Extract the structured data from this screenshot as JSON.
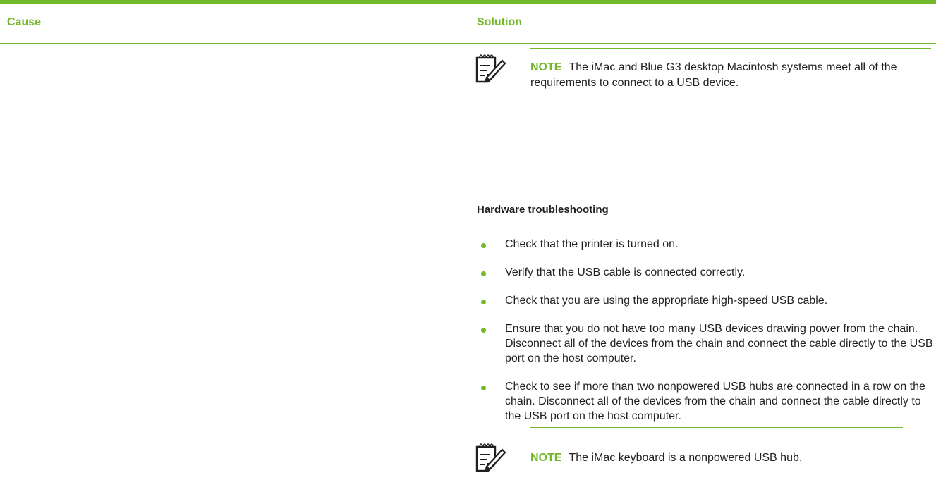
{
  "table": {
    "header": {
      "cause": "Cause",
      "solution": "Solution"
    }
  },
  "notes": [
    {
      "label": "NOTE",
      "icon": "note-pencil-icon",
      "text": "The iMac and Blue G3 desktop Macintosh systems meet all of the requirements to connect to a USB device."
    },
    {
      "label": "NOTE",
      "icon": "note-pencil-icon",
      "text": "The iMac keyboard is a nonpowered USB hub."
    }
  ],
  "section": {
    "heading": "Hardware troubleshooting",
    "bullets": [
      "Check that the printer is turned on.",
      "Verify that the USB cable is connected correctly.",
      "Check that you are using the appropriate high-speed USB cable.",
      "Ensure that you do not have too many USB devices drawing power from the chain. Disconnect all of the devices from the chain and connect the cable directly to the USB port on the host computer.",
      "Check to see if more than two nonpowered USB hubs are connected in a row on the chain. Disconnect all of the devices from the chain and connect the cable directly to the USB port on the host computer."
    ]
  },
  "colors": {
    "accent": "#73b72b",
    "text": "#231f20"
  }
}
